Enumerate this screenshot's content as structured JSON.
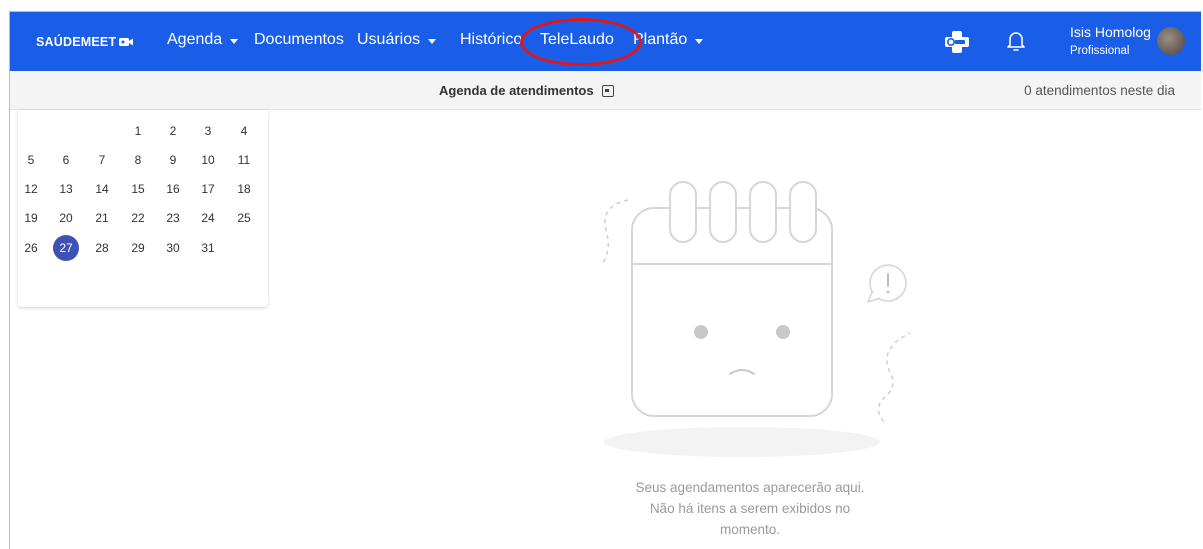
{
  "app": {
    "logo_text": "SAÚDEMEET"
  },
  "nav": {
    "items": [
      {
        "label": "Agenda",
        "has_caret": true
      },
      {
        "label": "Documentos",
        "has_caret": false
      },
      {
        "label": "Usuários",
        "has_caret": true
      },
      {
        "label": "Histórico",
        "has_caret": false
      },
      {
        "label": "TeleLaudo",
        "has_caret": false
      },
      {
        "label": "Plantão",
        "has_caret": true
      }
    ],
    "sus_icon": "sus-logo-icon",
    "bell_icon": "bell-icon"
  },
  "user": {
    "name": "Isis Homolog",
    "role": "Profissional"
  },
  "subheader": {
    "title": "Agenda de atendimentos",
    "count_text": "0 atendimentos neste dia"
  },
  "calendar": {
    "weeks": [
      [
        "",
        "",
        "",
        "1",
        "2",
        "3",
        "4"
      ],
      [
        "5",
        "6",
        "7",
        "8",
        "9",
        "10",
        "11"
      ],
      [
        "12",
        "13",
        "14",
        "15",
        "16",
        "17",
        "18"
      ],
      [
        "19",
        "20",
        "21",
        "22",
        "23",
        "24",
        "25"
      ],
      [
        "26",
        "27",
        "28",
        "29",
        "30",
        "31",
        ""
      ]
    ],
    "selected_day": "27"
  },
  "empty_state": {
    "line1": "Seus agendamentos aparecerão aqui.",
    "line2": "Não há itens a serem exibidos no",
    "line3": "momento."
  },
  "colors": {
    "navbar": "#1a5ee8",
    "selected_day": "#3f51b5",
    "annotation_circle": "#e31616"
  }
}
